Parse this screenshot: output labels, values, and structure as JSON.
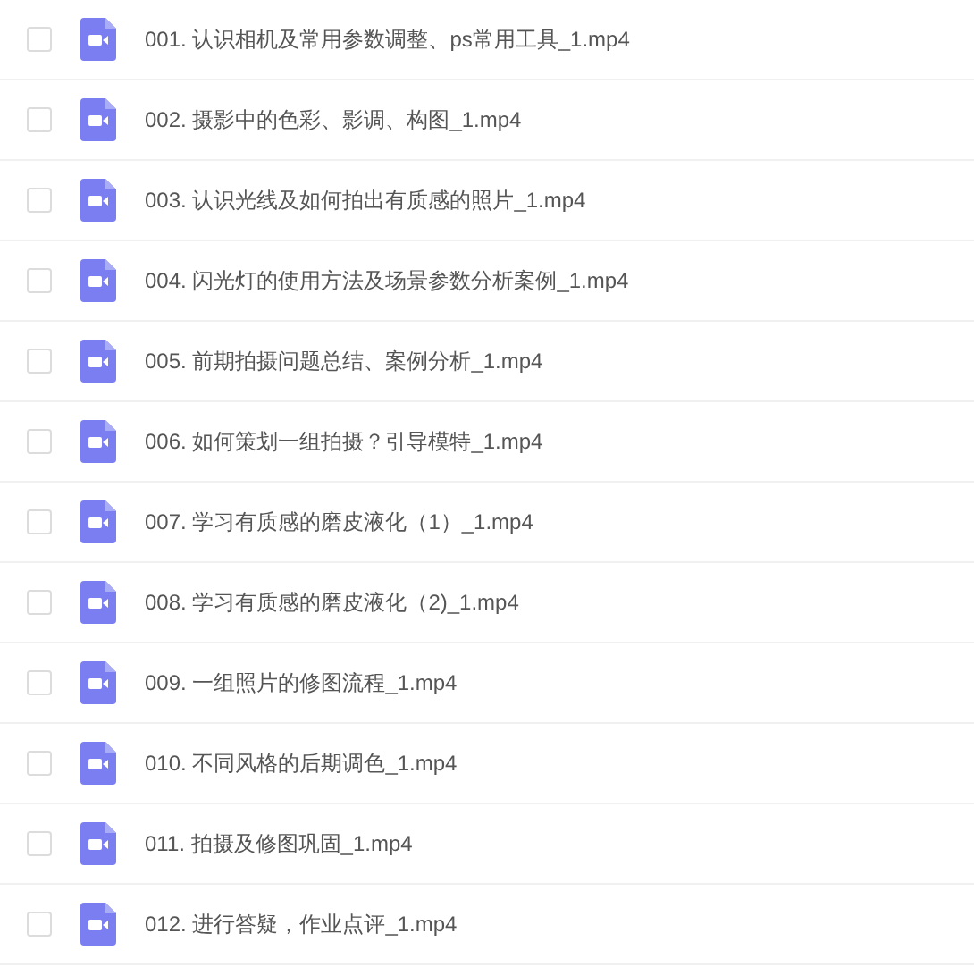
{
  "files": [
    {
      "name": "001. 认识相机及常用参数调整、ps常用工具_1.mp4",
      "checked": false
    },
    {
      "name": "002. 摄影中的色彩、影调、构图_1.mp4",
      "checked": false
    },
    {
      "name": "003. 认识光线及如何拍出有质感的照片_1.mp4",
      "checked": false
    },
    {
      "name": "004. 闪光灯的使用方法及场景参数分析案例_1.mp4",
      "checked": false
    },
    {
      "name": "005. 前期拍摄问题总结、案例分析_1.mp4",
      "checked": false
    },
    {
      "name": "006. 如何策划一组拍摄？引导模特_1.mp4",
      "checked": false
    },
    {
      "name": "007. 学习有质感的磨皮液化（1）_1.mp4",
      "checked": false
    },
    {
      "name": "008. 学习有质感的磨皮液化（2)_1.mp4",
      "checked": false
    },
    {
      "name": "009. 一组照片的修图流程_1.mp4",
      "checked": false
    },
    {
      "name": "010. 不同风格的后期调色_1.mp4",
      "checked": false
    },
    {
      "name": "011. 拍摄及修图巩固_1.mp4",
      "checked": false
    },
    {
      "name": "012. 进行答疑，作业点评_1.mp4",
      "checked": false
    }
  ]
}
